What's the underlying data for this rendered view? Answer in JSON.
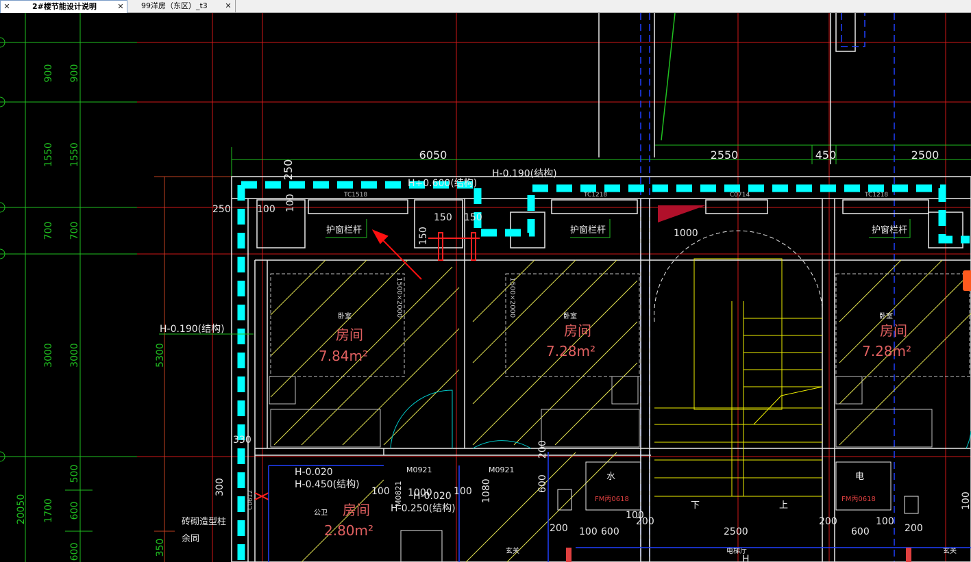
{
  "tabs": [
    {
      "label": "2#楼节能设计说明",
      "active": true
    },
    {
      "label": "99洋房（东区）_t3",
      "active": false
    }
  ],
  "left_dims_outer": [
    "900",
    "1550",
    "700",
    "3000",
    "1700",
    "20050"
  ],
  "left_dims_inner": [
    "900",
    "1550",
    "700",
    "3000",
    "500",
    "600",
    "600"
  ],
  "left_dims_third": [
    "5300",
    "350"
  ],
  "top_dims": {
    "d1": "6050",
    "d2": "2550",
    "d3": "450",
    "d4": "2500",
    "d5": "250"
  },
  "labels": {
    "level_struct_top": "H-0.190(结构)",
    "level_partial": "H+0.600(结构)",
    "level_left": "H-0.190(结构)",
    "win_tc1518": "TC1518",
    "win_tc1218a": "TC1218",
    "win_c0714": "C0714",
    "win_tc1218b": "TC1218",
    "guard_rail_1": "护窗栏杆",
    "guard_rail_2": "护窗栏杆",
    "guard_rail_3": "护窗栏杆",
    "dim_250": "250",
    "dim_100a": "100",
    "dim_100b": "100",
    "dim_150a": "150",
    "dim_150b": "150",
    "dim_150c": "150",
    "dim_1000": "1000",
    "bed_size_1": "1500×2000",
    "bed_size_2": "1500×2000",
    "bedroom_tag_1": "卧室",
    "bedroom_tag_2": "卧室",
    "bedroom_tag_3": "卧室",
    "room_1": "房间",
    "area_1": "7.84m²",
    "room_2": "房间",
    "area_2": "7.28m²",
    "room_3": "房间",
    "area_3": "7.28m²",
    "dim_330": "330",
    "dim_300": "300",
    "level_m0020": "H-0.020",
    "level_m0450": "H-0.450(结构)",
    "door_m0921a": "M0921",
    "door_m0921b": "M0921",
    "door_m0821": "M0821",
    "level_m0020b": "H-0.020",
    "level_m0250": "H-0.250(结构)",
    "room_4": "房间",
    "area_4": "2.80m²",
    "pillar_label": "砖砌造型柱",
    "surplus": "余同",
    "win_c0612": "C0612",
    "dim_1000b": "1000",
    "dim_100c": "100",
    "dim_100d": "100",
    "dim_1080": "1080",
    "dim_600a": "600",
    "dim_200a": "200",
    "dim_200b": "200",
    "dim_100e": "100",
    "dim_600b": "600",
    "dim_100f": "100",
    "dim_200c": "200",
    "dim_2500": "2500",
    "dim_200d": "200",
    "dim_600c": "600",
    "dim_100g": "100",
    "dim_200e": "200",
    "dim_100h": "100",
    "water": "水",
    "elec": "电",
    "fm_a": "FM丙0618",
    "fm_b": "FM丙0618",
    "down": "下",
    "up": "上",
    "elevator_hall": "电梯厅",
    "entry_a": "玄关",
    "entry_b": "玄关",
    "pub": "公卫",
    "h_mark": "H"
  },
  "colors": {
    "grid_red": "#e02020",
    "grid_green": "#20c020",
    "wall_white": "#e8e8e8",
    "dim_cyan": "#00ffff",
    "hatch_yellow": "#e0e050",
    "stair_yellow": "#f0f000",
    "blue": "#2040ff",
    "room_text": "#e06060"
  }
}
